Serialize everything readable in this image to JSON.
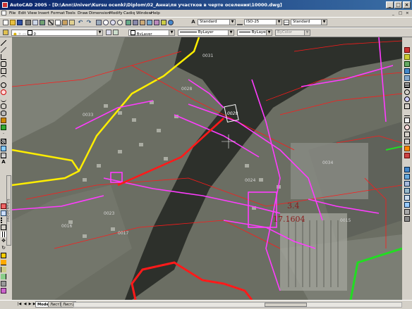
{
  "window": {
    "title": "AutoCAD 2005 - [D:\\Ann\\Univer\\Kursu ocenki\\Diplom\\02_Анна\\ля участков в черте оселения\\10000.dwg]",
    "controls": [
      "_",
      "□",
      "×"
    ]
  },
  "menu": {
    "items": [
      "File",
      "Edit",
      "View",
      "Insert",
      "Format",
      "Tools",
      "Draw",
      "Dimension",
      "Modify",
      "Cadiq",
      "Window",
      "Help"
    ],
    "doc_controls": [
      "_",
      "□",
      "×"
    ]
  },
  "toolbar": {
    "text_style": "Standard",
    "dim_style": "ISO-25",
    "table_style": "Standard",
    "layer": "0",
    "color": "ByLayer",
    "linetype": "ByLayer",
    "lineweight": "ByLayer",
    "plot_style": "ByColor"
  },
  "drawing": {
    "parcel_labels": [
      "0029",
      "0031",
      "0028",
      "0033",
      "0023",
      "0015",
      "0016",
      "0017",
      "0024",
      "0034"
    ],
    "selected_parcel": "0029",
    "annotation_top": "3.4",
    "annotation_bottom": "17.1604",
    "colors": {
      "river": "#2d302b",
      "land": "#6b6e63",
      "magenta": "#ff3cff",
      "red_line": "#ff1a1a",
      "yellow_road": "#ffee00",
      "green_line": "#22dd22",
      "annotation": "#8b1a1a"
    }
  },
  "palette": {
    "properties_label": "PROPERTIES"
  },
  "statusbar": {
    "tabs": [
      "Model",
      "Лист1",
      "Лист2"
    ],
    "active_tab": "Model"
  }
}
